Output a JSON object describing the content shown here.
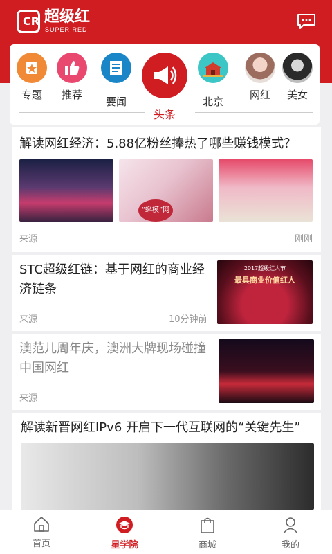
{
  "header": {
    "logo_mark": "CR",
    "brand": "超级红",
    "brand_sub": "SUPER RED"
  },
  "categories": [
    {
      "label": "专题",
      "icon": "star-badge-icon",
      "color": "#f08a36"
    },
    {
      "label": "推荐",
      "icon": "thumbs-up-icon",
      "color": "#e9496f"
    },
    {
      "label": "要闻",
      "icon": "newspaper-icon",
      "color": "#1a86c7"
    },
    {
      "label": "头条",
      "icon": "megaphone-icon",
      "color": "#d01d22"
    },
    {
      "label": "北京",
      "icon": "tiananmen-icon",
      "color": "#3dc6c6"
    },
    {
      "label": "网红",
      "icon": "avatar-photo-icon",
      "color": "#c9a59b"
    },
    {
      "label": "美女",
      "icon": "avatar-photo-icon",
      "color": "#555555"
    }
  ],
  "feed": {
    "a1": {
      "title": "解读网红经济：5.88亿粉丝捧热了哪些赚钱模式？",
      "source": "来源",
      "time": "刚刚",
      "img2_text": "“蝌模”网红"
    },
    "a2": {
      "title": "STC超级红链：基于网红的商业经济链条",
      "source": "来源",
      "time": "10分钟前",
      "img_text_top": "2017超级红人节",
      "img_text": "最具商业价值红人"
    },
    "a3": {
      "title": "澳范儿周年庆，澳洲大牌现场碰撞中国网红",
      "source": "来源"
    },
    "a4": {
      "title": "解读新晋网红IPv6 开启下一代互联网的“关键先生”"
    }
  },
  "tabs": [
    {
      "label": "首页",
      "icon": "home-icon"
    },
    {
      "label": "星学院",
      "icon": "graduation-cap-icon",
      "active": true
    },
    {
      "label": "商城",
      "icon": "shopping-bag-icon"
    },
    {
      "label": "我的",
      "icon": "user-icon"
    }
  ],
  "colors": {
    "brand_red": "#d01d22",
    "panel_bg": "#efeff1"
  }
}
